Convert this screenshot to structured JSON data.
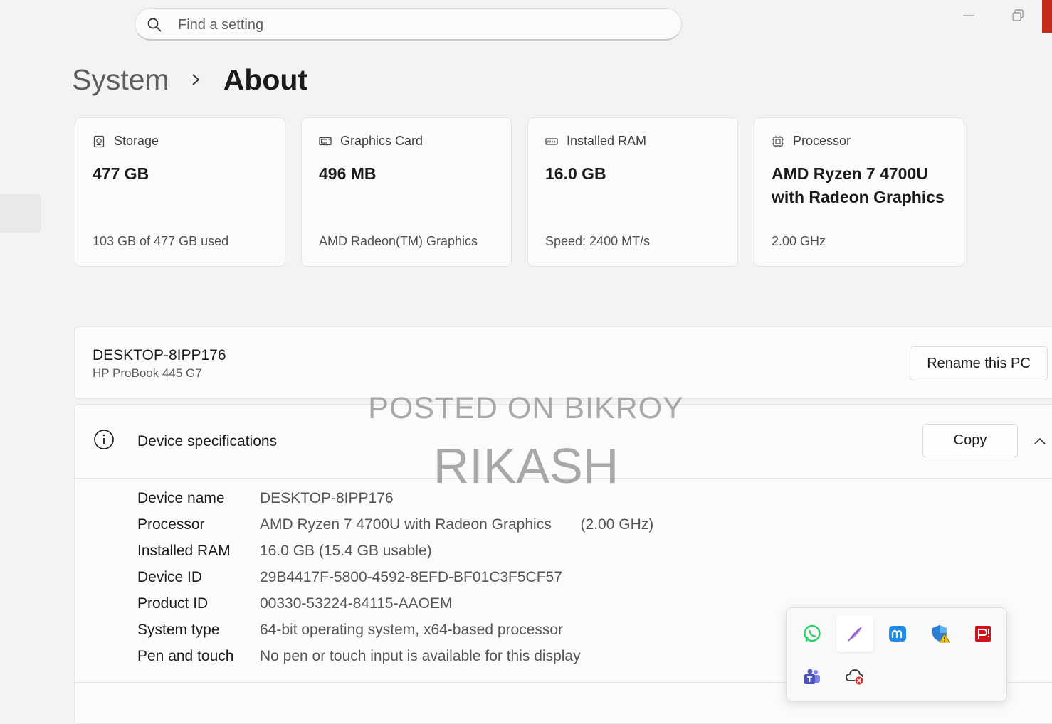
{
  "search": {
    "placeholder": "Find a setting"
  },
  "breadcrumb": {
    "parent": "System",
    "current": "About"
  },
  "cards": [
    {
      "icon": "storage-icon",
      "label": "Storage",
      "value": "477 GB",
      "sub": "103 GB of 477 GB used"
    },
    {
      "icon": "graphics-card-icon",
      "label": "Graphics Card",
      "value": "496 MB",
      "sub": "AMD Radeon(TM) Graphics"
    },
    {
      "icon": "ram-icon",
      "label": "Installed RAM",
      "value": "16.0 GB",
      "sub": "Speed: 2400 MT/s"
    },
    {
      "icon": "processor-icon",
      "label": "Processor",
      "value": "AMD Ryzen 7 4700U with Radeon Graphics",
      "sub": "2.00 GHz"
    }
  ],
  "pc": {
    "name": "DESKTOP-8IPP176",
    "model": "HP ProBook 445 G7",
    "rename_label": "Rename this PC"
  },
  "specs": {
    "title": "Device specifications",
    "copy_label": "Copy",
    "rows": [
      {
        "key": "Device name",
        "value": "DESKTOP-8IPP176"
      },
      {
        "key": "Processor",
        "value": "AMD Ryzen 7 4700U with Radeon Graphics       (2.00 GHz)"
      },
      {
        "key": "Installed RAM",
        "value": "16.0 GB (15.4 GB usable)"
      },
      {
        "key": "Device ID",
        "value": "29B4417F-5800-4592-8EFD-BF01C3F5CF57"
      },
      {
        "key": "Product ID",
        "value": "00330-53224-84115-AAOEM"
      },
      {
        "key": "System type",
        "value": "64-bit operating system, x64-based processor"
      },
      {
        "key": "Pen and touch",
        "value": "No pen or touch input is available for this display"
      }
    ]
  },
  "watermark": {
    "line1": "POSTED ON BIKROY",
    "line2": "RIKASH"
  },
  "tray_icons": [
    "whatsapp-icon",
    "pen-app-icon",
    "ms-app-icon",
    "security-warning-icon",
    "pdf-reader-icon",
    "teams-icon",
    "cloud-error-icon"
  ],
  "colors": {
    "accent_red": "#c42b1c",
    "background": "#f3f3f3",
    "card": "#fbfbfb"
  }
}
